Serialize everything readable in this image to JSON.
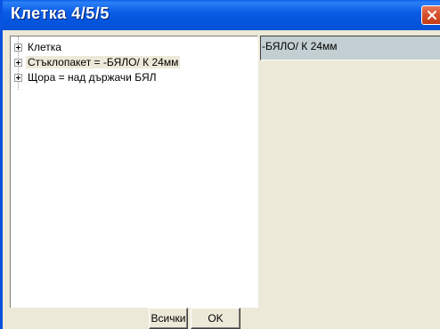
{
  "window": {
    "title": "Клетка  4/5/5",
    "close_icon": "close-icon"
  },
  "tree": {
    "nodes": [
      {
        "label": "Клетка",
        "selected": false
      },
      {
        "label": "Стъклопакет  = -БЯЛО/ К 24мм",
        "selected": true
      },
      {
        "label": "Щора  = над държачи БЯЛ",
        "selected": false
      }
    ]
  },
  "buttons": {
    "all_label": "Всички",
    "ok_label": "OK"
  },
  "value_panel": {
    "value": "-БЯЛО/ К 24мм"
  },
  "colors": {
    "titlebar": "#0a5fe8",
    "close_button": "#d6502a",
    "selection": "#ece9d8",
    "value_field": "#c3cfd2"
  }
}
